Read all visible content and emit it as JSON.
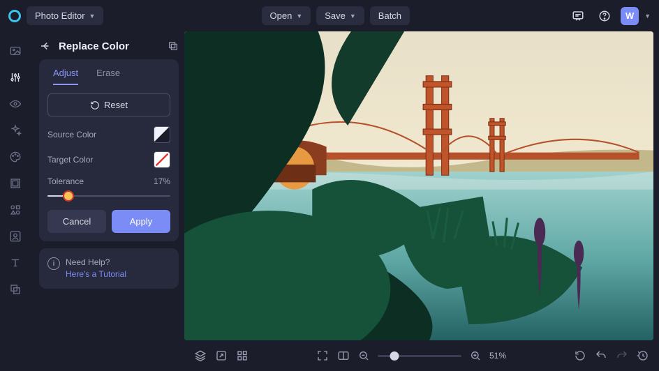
{
  "header": {
    "app_menu": "Photo Editor",
    "open": "Open",
    "save": "Save",
    "batch": "Batch",
    "avatar_initial": "W"
  },
  "panel": {
    "title": "Replace Color",
    "tabs": {
      "adjust": "Adjust",
      "erase": "Erase"
    },
    "reset": "Reset",
    "source_label": "Source Color",
    "target_label": "Target Color",
    "tolerance_label": "Tolerance",
    "tolerance_value": "17",
    "tolerance_pct_suffix": "%",
    "cancel": "Cancel",
    "apply": "Apply"
  },
  "help": {
    "heading": "Need Help?",
    "link": "Here's a Tutorial"
  },
  "footer": {
    "zoom_value": "51%",
    "zoom_fraction": 0.51
  },
  "colors": {
    "accent": "#7b8cf6"
  }
}
